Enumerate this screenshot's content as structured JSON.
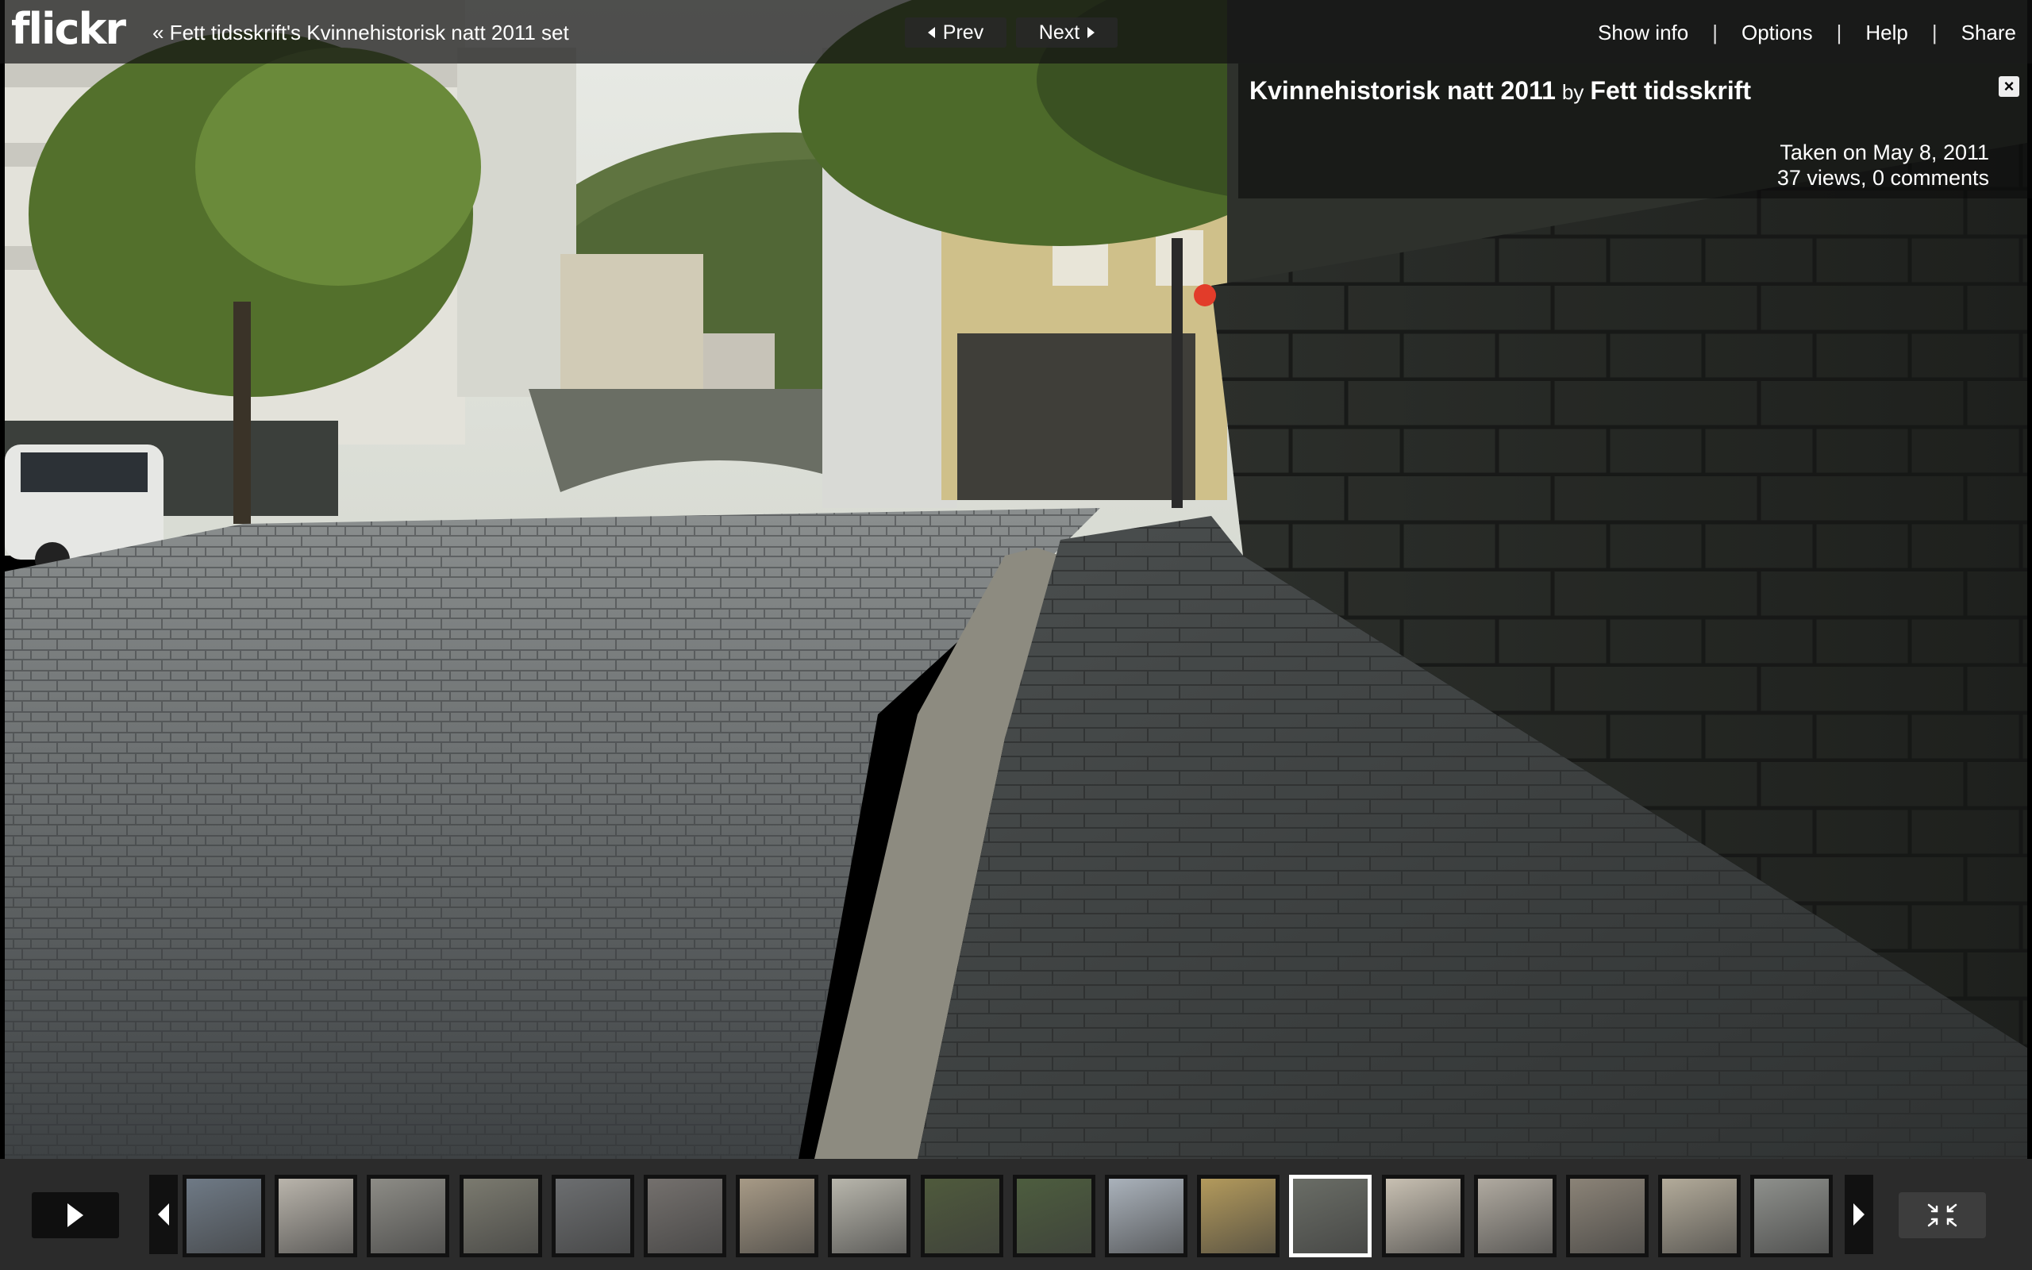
{
  "header": {
    "logo_text": "flickr",
    "set_link": "« Fett tidsskrift's Kvinnehistorisk natt 2011 set",
    "prev_label": "Prev",
    "next_label": "Next",
    "menu": [
      "Show info",
      "Options",
      "Help",
      "Share"
    ],
    "separator": "|"
  },
  "photo": {
    "title": "Kvinnehistorisk natt 2011",
    "by": "by",
    "owner": "Fett tidsskrift",
    "taken": "Taken on May 8, 2011",
    "stats": "37 views, 0 comments",
    "close_glyph": "×"
  },
  "filmstrip": {
    "current_index": 12,
    "thumbnails": [
      {
        "tone": "#6f7a86"
      },
      {
        "tone": "#b9b4ab"
      },
      {
        "tone": "#8d8c86"
      },
      {
        "tone": "#7b7a6f"
      },
      {
        "tone": "#6c6e70"
      },
      {
        "tone": "#74706d"
      },
      {
        "tone": "#a79a86"
      },
      {
        "tone": "#b8b6ac"
      },
      {
        "tone": "#4f5a3c"
      },
      {
        "tone": "#4d5d3e"
      },
      {
        "tone": "#aab2bb"
      },
      {
        "tone": "#b39a5c"
      },
      {
        "tone": "#6a6d66"
      },
      {
        "tone": "#c8c0b2"
      },
      {
        "tone": "#b0aaa0"
      },
      {
        "tone": "#8b8377"
      },
      {
        "tone": "#b3ab9a"
      },
      {
        "tone": "#8e908c"
      }
    ]
  },
  "colors": {
    "bar_bg": "#121212",
    "filmstrip_bg": "#2b2b2b",
    "current_border": "#ffffff"
  },
  "icons": {
    "play": "play-icon",
    "strip_left": "chevron-left-icon",
    "strip_right": "chevron-right-icon",
    "collapse": "collapse-icon",
    "close": "close-icon"
  }
}
